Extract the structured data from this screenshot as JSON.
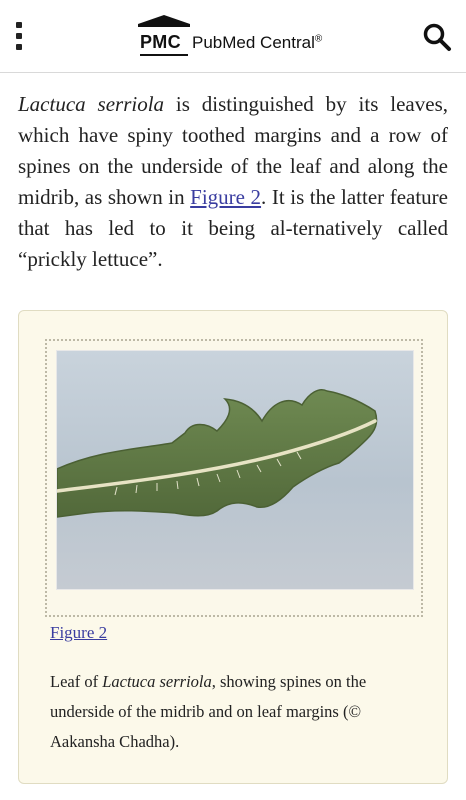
{
  "header": {
    "brand_short": "PMC",
    "brand_name": "PubMed Central",
    "registered_mark": "®"
  },
  "article": {
    "species_italic": "Lactuca serriola",
    "text_part1": " is distinguished by its leaves, which have spiny toothed margins and a row of spines on the underside of the leaf and along the midrib, as shown in ",
    "figure_ref": "Figure 2",
    "text_part2": ". It is the latter feature that has led to it being al-ternatively called “prickly lettuce”."
  },
  "figure": {
    "link_label": "Figure 2",
    "caption_prefix": "Leaf of ",
    "caption_species": "Lactuca serriola",
    "caption_rest": ", showing spines on the underside of the midrib and on leaf margins (© Aakansha Chadha)."
  },
  "icons": {
    "menu": "kebab-menu-icon",
    "search": "search-icon"
  },
  "colors": {
    "link": "#3a3da0",
    "figure_bg": "#fcf9ea"
  }
}
